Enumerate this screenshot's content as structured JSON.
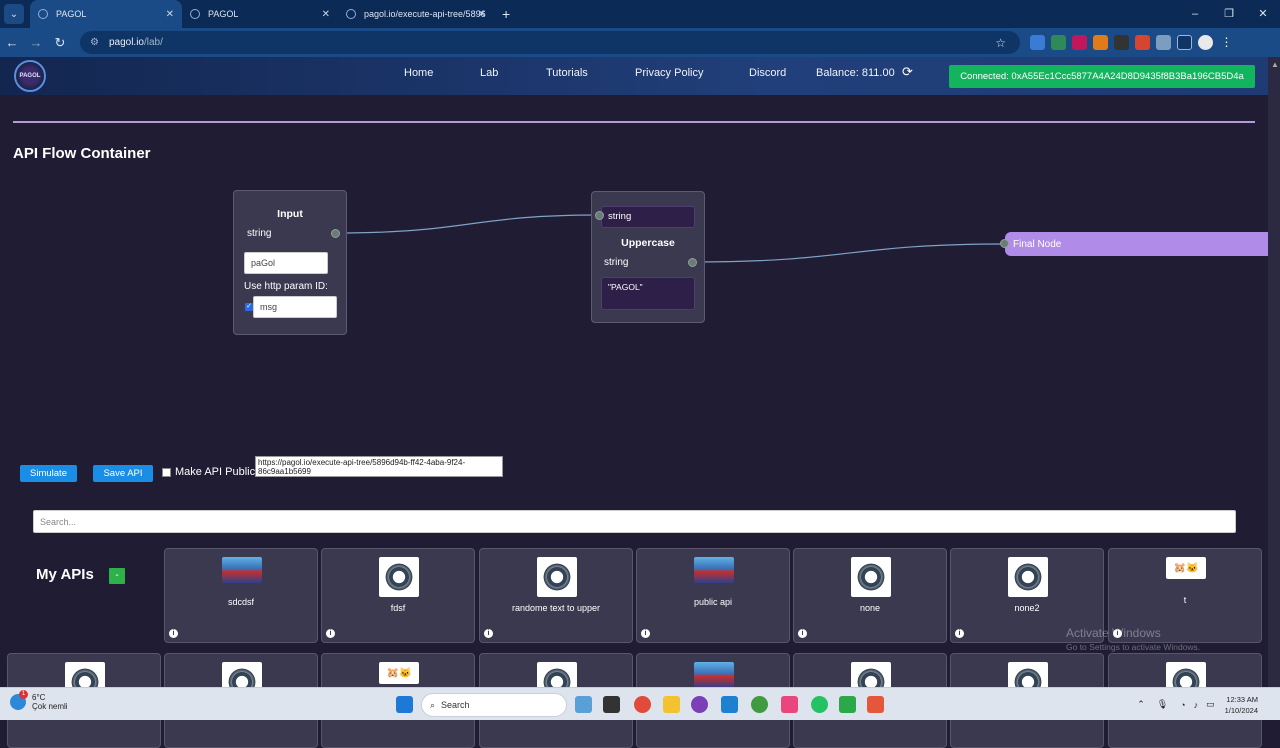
{
  "browser": {
    "tabs": [
      {
        "title": "PAGOL",
        "active": true
      },
      {
        "title": "PAGOL",
        "active": false
      },
      {
        "title": "pagol.io/execute-api-tree/5896",
        "active": false
      }
    ],
    "new_tab": "+",
    "url_host": "pagol.io",
    "url_path": "/lab/",
    "window_controls": [
      "–",
      "❐",
      "✕"
    ]
  },
  "site": {
    "logo_text": "PAGOL",
    "nav": [
      "Home",
      "Lab",
      "Tutorials",
      "Privacy Policy",
      "Discord"
    ],
    "balance": "Balance: 811.00",
    "connected": "Connected: 0xA55Ec1Ccc5877A4A24D8D9435f8B3Ba196CB5D4a"
  },
  "flow": {
    "title": "API Flow Container",
    "input_node": {
      "title": "Input",
      "type": "string",
      "value": "paGol",
      "http_param_label": "Use http param ID:",
      "http_param_value": "msg",
      "http_param_checked": true
    },
    "uppercase_node": {
      "input_type": "string",
      "title": "Uppercase",
      "output_type": "string",
      "output_value": "\"PAGOL\""
    },
    "final_node": {
      "label": "Final Node"
    }
  },
  "actions": {
    "simulate": "Simulate",
    "save": "Save API",
    "make_public": "Make API Public",
    "api_url": "https://pagol.io/execute-api-tree/5896d94b-ff42-4aba-9f24-86c9aa1b5699"
  },
  "search": {
    "placeholder": "Search..."
  },
  "my_apis": {
    "title": "My APIs",
    "collapse": "-",
    "cards": [
      {
        "name": "sdcdsf",
        "thumb": "photo"
      },
      {
        "name": "fdsf",
        "thumb": "gear"
      },
      {
        "name": "randome text to upper",
        "thumb": "gear"
      },
      {
        "name": "public api",
        "thumb": "photo"
      },
      {
        "name": "none",
        "thumb": "gear"
      },
      {
        "name": "none2",
        "thumb": "gear"
      },
      {
        "name": "t",
        "thumb": "cats"
      }
    ],
    "row2_thumbs": [
      "gear",
      "gear",
      "cats",
      "gear",
      "photo",
      "gear",
      "gear",
      "gear"
    ]
  },
  "watermark": {
    "line1": "Activate Windows",
    "line2": "Go to Settings to activate Windows."
  },
  "taskbar": {
    "weather_temp": "6°C",
    "weather_desc": "Çok nemli",
    "weather_badge": "1",
    "search": "Search",
    "time": "12:33 AM",
    "date": "1/10/2024"
  }
}
